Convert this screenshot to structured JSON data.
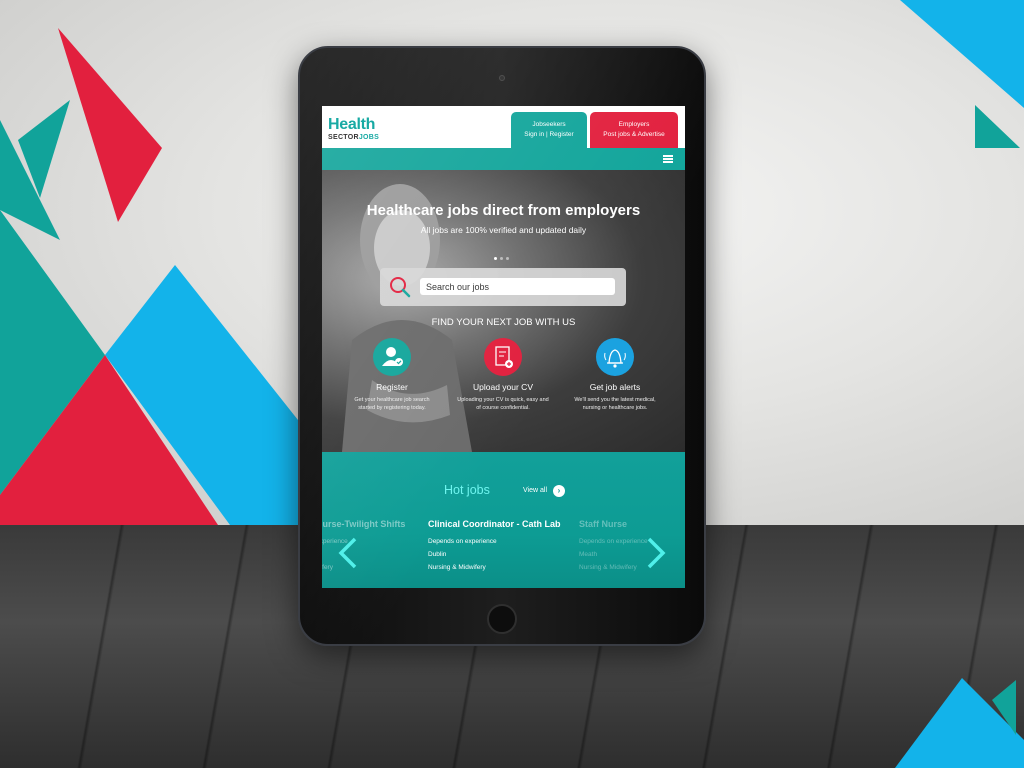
{
  "header": {
    "logo_word": "Health",
    "logo_sub_a": "SECTOR",
    "logo_sub_b": "JOBS",
    "jobseekers": {
      "title": "Jobseekers",
      "links": "Sign in | Register"
    },
    "employers": {
      "title": "Employers",
      "links": "Post jobs & Advertise"
    }
  },
  "hero": {
    "title": "Healthcare jobs direct from employers",
    "subtitle": "All jobs are 100% verified and updated daily",
    "search_placeholder": "Search our jobs",
    "find_next": "FIND YOUR NEXT JOB WITH US",
    "features": [
      {
        "title": "Register",
        "desc": "Get your healthcare job search started by registering today."
      },
      {
        "title": "Upload your CV",
        "desc": "Uploading your CV is quick, easy and of course confidential."
      },
      {
        "title": "Get job alerts",
        "desc": "We'll send you the latest medical, nursing or healthcare jobs."
      }
    ]
  },
  "hot_jobs": {
    "title": "Hot jobs",
    "view_all": "View all",
    "jobs": [
      {
        "title": "Nurse-Twilight Shifts",
        "salary": "experience",
        "location": "",
        "category": "wifery"
      },
      {
        "title": "Clinical Coordinator - Cath Lab",
        "salary": "Depends on experience",
        "location": "Dublin",
        "category": "Nursing & Midwifery"
      },
      {
        "title": "Staff Nurse",
        "salary": "Depends on experience",
        "location": "Meath",
        "category": "Nursing & Midwifery"
      }
    ]
  },
  "colors": {
    "teal": "#12a59b",
    "red": "#e2203e",
    "blue": "#1ba2e0",
    "hot_title": "#6ef5ef"
  }
}
